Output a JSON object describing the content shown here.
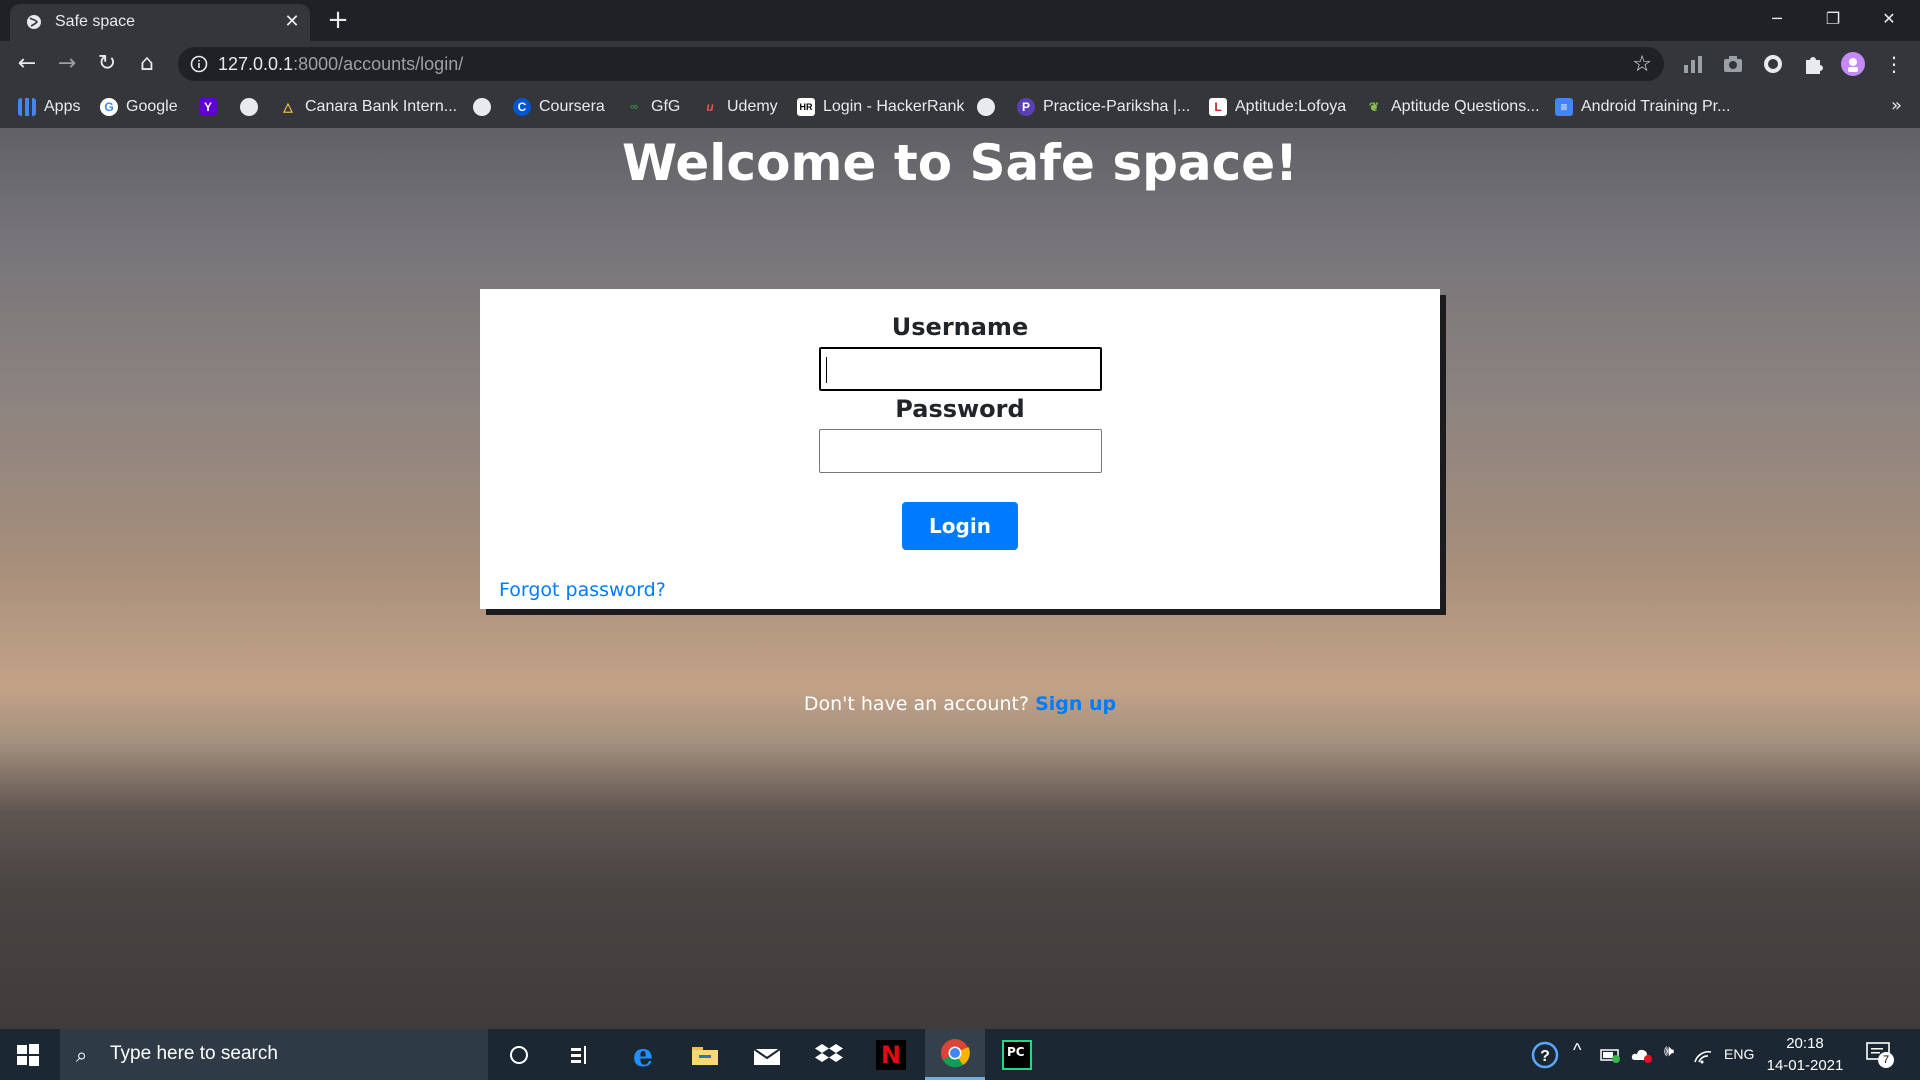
{
  "browser": {
    "tab_title": "Safe space",
    "url_host": "127.0.0.1",
    "url_rest": ":8000/accounts/login/",
    "bookmarks": [
      {
        "label": "Apps",
        "icon": "apps-grid-icon"
      },
      {
        "label": "Google",
        "icon": "google-icon"
      },
      {
        "label": "",
        "icon": "yahoo-icon"
      },
      {
        "label": "",
        "icon": "globe-icon"
      },
      {
        "label": "Canara Bank Intern...",
        "icon": "canara-icon"
      },
      {
        "label": "",
        "icon": "globe-icon"
      },
      {
        "label": "Coursera",
        "icon": "coursera-icon"
      },
      {
        "label": "GfG",
        "icon": "gfg-icon"
      },
      {
        "label": "Udemy",
        "icon": "udemy-icon"
      },
      {
        "label": "Login - HackerRank",
        "icon": "hackerrank-icon"
      },
      {
        "label": "",
        "icon": "globe-icon"
      },
      {
        "label": "Practice-Pariksha |...",
        "icon": "pariksha-icon"
      },
      {
        "label": "Aptitude:Lofoya",
        "icon": "lofoya-icon"
      },
      {
        "label": "Aptitude Questions...",
        "icon": "leaf-icon"
      },
      {
        "label": "Android Training Pr...",
        "icon": "docs-icon"
      }
    ],
    "more_bookmarks": "»",
    "colors": {
      "frame": "#202124",
      "toolbar": "#35363a",
      "text": "#e8eaed"
    }
  },
  "page": {
    "heading": "Welcome to Safe space!",
    "form": {
      "username_label": "Username",
      "password_label": "Password",
      "username_value": "",
      "password_value": "",
      "login_label": "Login",
      "forgot_label": "Forgot password?"
    },
    "signup_prompt": "Don't have an account?",
    "signup_link": "Sign up",
    "colors": {
      "accent": "#007bff",
      "card": "#ffffff"
    }
  },
  "taskbar": {
    "search_placeholder": "Type here to search",
    "apps": [
      "cortana-icon",
      "task-view-icon",
      "edge-icon",
      "file-explorer-icon",
      "mail-icon",
      "dropbox-icon",
      "netflix-icon",
      "chrome-icon",
      "pycharm-icon"
    ],
    "language": "ENG",
    "time": "20:18",
    "date": "14-01-2021",
    "notifications": "7"
  }
}
